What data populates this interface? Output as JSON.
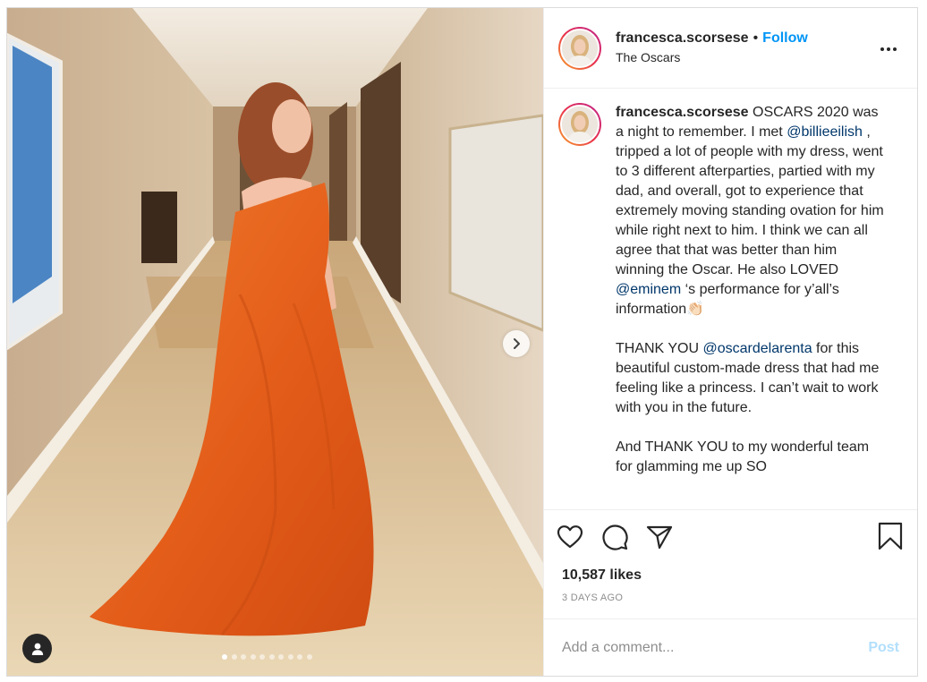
{
  "post": {
    "username": "francesca.scorsese",
    "separator": "•",
    "follow_label": "Follow",
    "location": "The Oscars"
  },
  "caption": {
    "username": "francesca.scorsese",
    "seg1": " OSCARS 2020 was a night to remember. I met ",
    "mention1": "@billieeilish",
    "seg2": " , tripped a lot of people with my dress, went to 3 different afterparties, partied with my dad, and overall, got to experience that extremely moving standing ovation for him while right next to him. I think we can all agree that that was better than him winning the Oscar. He also LOVED ",
    "mention2": "@eminem",
    "seg3": " ‘s performance for y’all’s information👏🏻\n\nTHANK YOU ",
    "mention3": "@oscardelarenta",
    "seg4": " for this beautiful custom-made dress that had me feeling like a princess. I can’t wait to work with you in the future.\n\nAnd THANK YOU to my wonderful team for glamming me up SO"
  },
  "stats": {
    "likes": "10,587 likes",
    "timestamp": "3 DAYS AGO"
  },
  "comment": {
    "placeholder": "Add a comment...",
    "post_label": "Post"
  },
  "carousel": {
    "total_slides": 10,
    "active_index": 0
  },
  "icons": {
    "more": "more-options-icon",
    "like": "heart-icon",
    "comment": "comment-bubble-icon",
    "share": "paper-plane-icon",
    "save": "bookmark-icon",
    "next": "chevron-right-icon",
    "tags": "user-tag-icon"
  },
  "colors": {
    "accent": "#0095f6",
    "mention": "#00376b",
    "muted": "#8e8e8e",
    "post_disabled": "#b2dffc",
    "dress": "#e5611f"
  }
}
